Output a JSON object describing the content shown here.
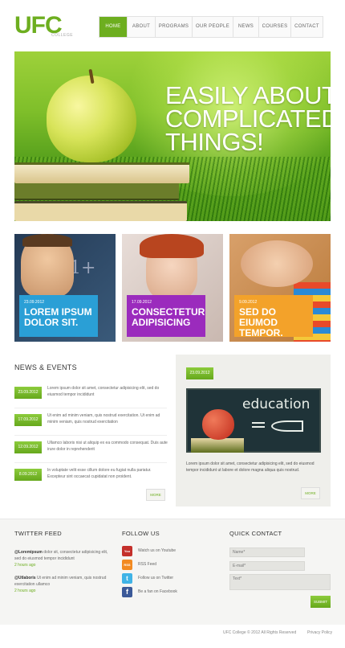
{
  "header": {
    "logo": "UFC",
    "tagline": "COLLEGE",
    "nav": [
      {
        "label": "HOME",
        "active": true
      },
      {
        "label": "ABOUT",
        "active": false
      },
      {
        "label": "PROGRAMS",
        "active": false
      },
      {
        "label": "OUR PEOPLE",
        "active": false
      },
      {
        "label": "NEWS",
        "active": false
      },
      {
        "label": "COURSES",
        "active": false
      },
      {
        "label": "CONTACT",
        "active": false
      }
    ]
  },
  "hero": {
    "line1": "EASILY ABOUT",
    "line2": "COMPLICATED",
    "line3": "THINGS!"
  },
  "tiles": [
    {
      "date": "23.09.2012",
      "title": "LOREM IPSUM DOLOR SIT.",
      "color": "#2a9fd6"
    },
    {
      "date": "17.09.2012",
      "title": "CONSECTETUR ADIPISICING",
      "color": "#9b2bbd"
    },
    {
      "date": "9.09.2012",
      "title": "SED DO EIUMOD TEMPOR.",
      "color": "#f3a22a"
    }
  ],
  "news": {
    "title": "NEWS & EVENTS",
    "items": [
      {
        "date": "23.09.2012",
        "text": "Lorem ipsum dolor sit amet, consectetur adipisicing elit, sed do eiusmod tempor incididunt"
      },
      {
        "date": "17.09.2012",
        "text": "Ut enim ad minim veniam, quis nostrud exercitation. Ut enim ad minim veniam, quis nostrud exercitation"
      },
      {
        "date": "12.09.2012",
        "text": "Ullamco laboris nisi ut aliquip ex ea commodo consequat. Duis aute irure dolor in reprehenderit"
      },
      {
        "date": "8.09.2012",
        "text": "In voluptate velit esse cillum dolore eu fugiat nulla pariatur. Excepteur sint occaecat cupidatat non proident."
      }
    ],
    "more": "MORE"
  },
  "featured": {
    "date": "23.09.2012",
    "board_text": "education",
    "text": "Lorem ipsum dolor sit amet, consectetur adipisicing elit, sed do eiusmod tempor incididunt ut labore et dolore magna aliqua quis nostrud.",
    "more": "MORE"
  },
  "footer": {
    "twitter": {
      "title": "TWITTER FEED",
      "tweets": [
        {
          "user": "@Loremipsum",
          "text": "dolor sit, consectetur adipisicing elit, sed do eiusmod tempor incididunt",
          "time": "2 hours ago"
        },
        {
          "user": "@Utlaboris",
          "text": "Ut enim ad minim veniam, quis nostrud exercitation ullamco",
          "time": "2 hours ago"
        }
      ]
    },
    "follow": {
      "title": "FOLLOW US",
      "items": [
        {
          "icon": "youtube-icon",
          "label": "Watch us on Youtube",
          "color": "#c4302b",
          "abbr": "You Tube"
        },
        {
          "icon": "rss-icon",
          "label": "RSS Feed",
          "color": "#f28a21",
          "abbr": "RSS"
        },
        {
          "icon": "twitter-icon",
          "label": "Follow us on Twitter",
          "color": "#3fb3e6",
          "abbr": "t"
        },
        {
          "icon": "facebook-icon",
          "label": "Be a fan on Facebook",
          "color": "#3b5998",
          "abbr": "f"
        }
      ]
    },
    "contact": {
      "title": "QUICK CONTACT",
      "name_placeholder": "Name*",
      "email_placeholder": "E-mail*",
      "text_placeholder": "Text*",
      "submit": "SUBMIT"
    },
    "copyright": "UFC College © 2012 All Rights Reserved",
    "privacy": "Privacy Policy"
  },
  "colors": {
    "accent": "#6dae1f"
  }
}
